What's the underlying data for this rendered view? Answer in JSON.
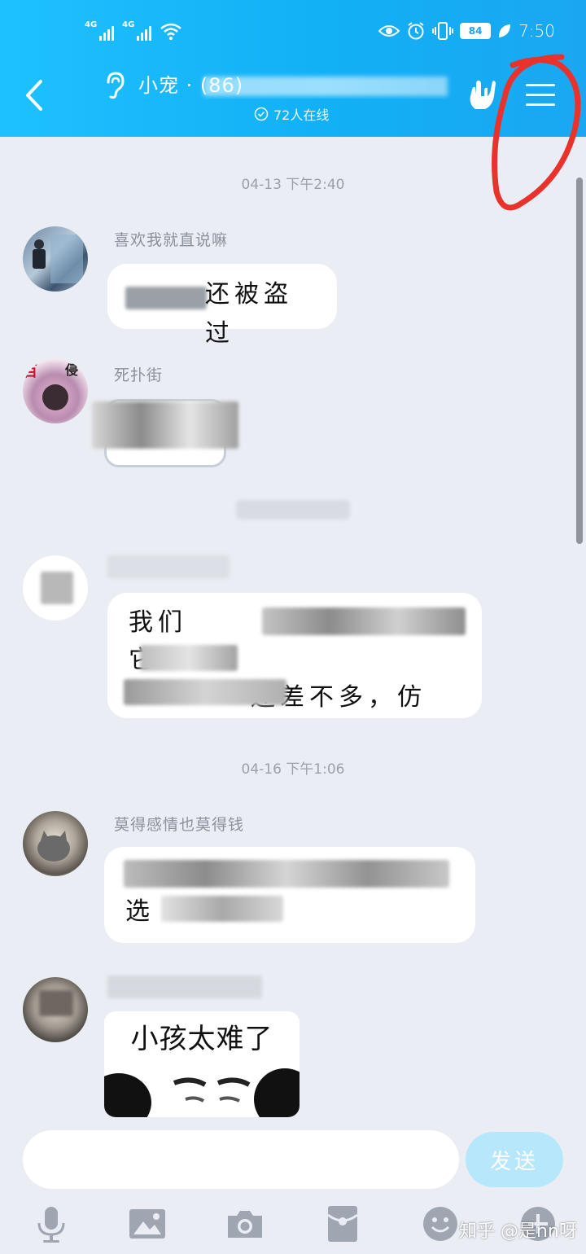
{
  "status_bar": {
    "sim1_label": "4G",
    "sim2_label": "4G",
    "battery": "84",
    "time": "7:50"
  },
  "header": {
    "title": "小宠   ·    (86)",
    "online": "72人在线"
  },
  "messages": [
    {
      "type": "timestamp",
      "text": "04-13 下午2:40"
    },
    {
      "type": "message",
      "sender": "喜欢我就直说嘛",
      "text": "还被盗过"
    },
    {
      "type": "message",
      "sender": "死扑街",
      "text": ""
    },
    {
      "type": "message",
      "sender": "",
      "lines": [
        "我们",
        "它",
        "还差不多，仿"
      ]
    },
    {
      "type": "timestamp",
      "text": "04-16 下午1:06"
    },
    {
      "type": "message",
      "sender": "莫得感情也莫得钱",
      "lines": [
        "",
        "选"
      ]
    },
    {
      "type": "message",
      "sender": "",
      "sticker_text": "小孩太难了"
    }
  ],
  "input": {
    "placeholder": ""
  },
  "send_label": "发送",
  "watermark": "知乎 @是nn呀",
  "colors": {
    "header": "#15b4f6",
    "background": "#eaedf4",
    "send": "#b6e7fb",
    "annotation": "#e8322b"
  }
}
